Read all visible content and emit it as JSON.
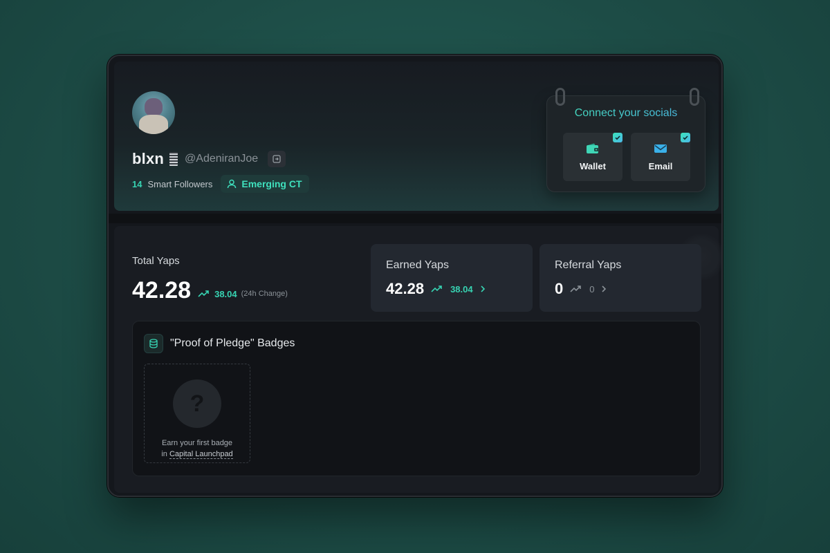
{
  "profile": {
    "display_name": "blxn",
    "handle": "@AdeniranJoe",
    "smart_followers_count": "14",
    "smart_followers_label": "Smart Followers",
    "tier": "Emerging CT"
  },
  "socials": {
    "title": "Connect your socials",
    "items": [
      {
        "label": "Wallet",
        "icon": "wallet-icon",
        "connected": true
      },
      {
        "label": "Email",
        "icon": "email-icon",
        "connected": true
      }
    ]
  },
  "stats": {
    "total": {
      "title": "Total Yaps",
      "value": "42.28",
      "change": "38.04",
      "change_label": "(24h Change)"
    },
    "earned": {
      "title": "Earned Yaps",
      "value": "42.28",
      "change": "38.04"
    },
    "referral": {
      "title": "Referral Yaps",
      "value": "0",
      "change": "0"
    }
  },
  "badges": {
    "title": "\"Proof of Pledge\" Badges",
    "empty_text": "Earn your first badge",
    "empty_prefix": "in",
    "empty_link": "Capital Launchpad",
    "placeholder_glyph": "?"
  },
  "colors": {
    "accent": "#37d3b2",
    "accent_blue": "#4ab3e6",
    "background": "#14171c"
  }
}
